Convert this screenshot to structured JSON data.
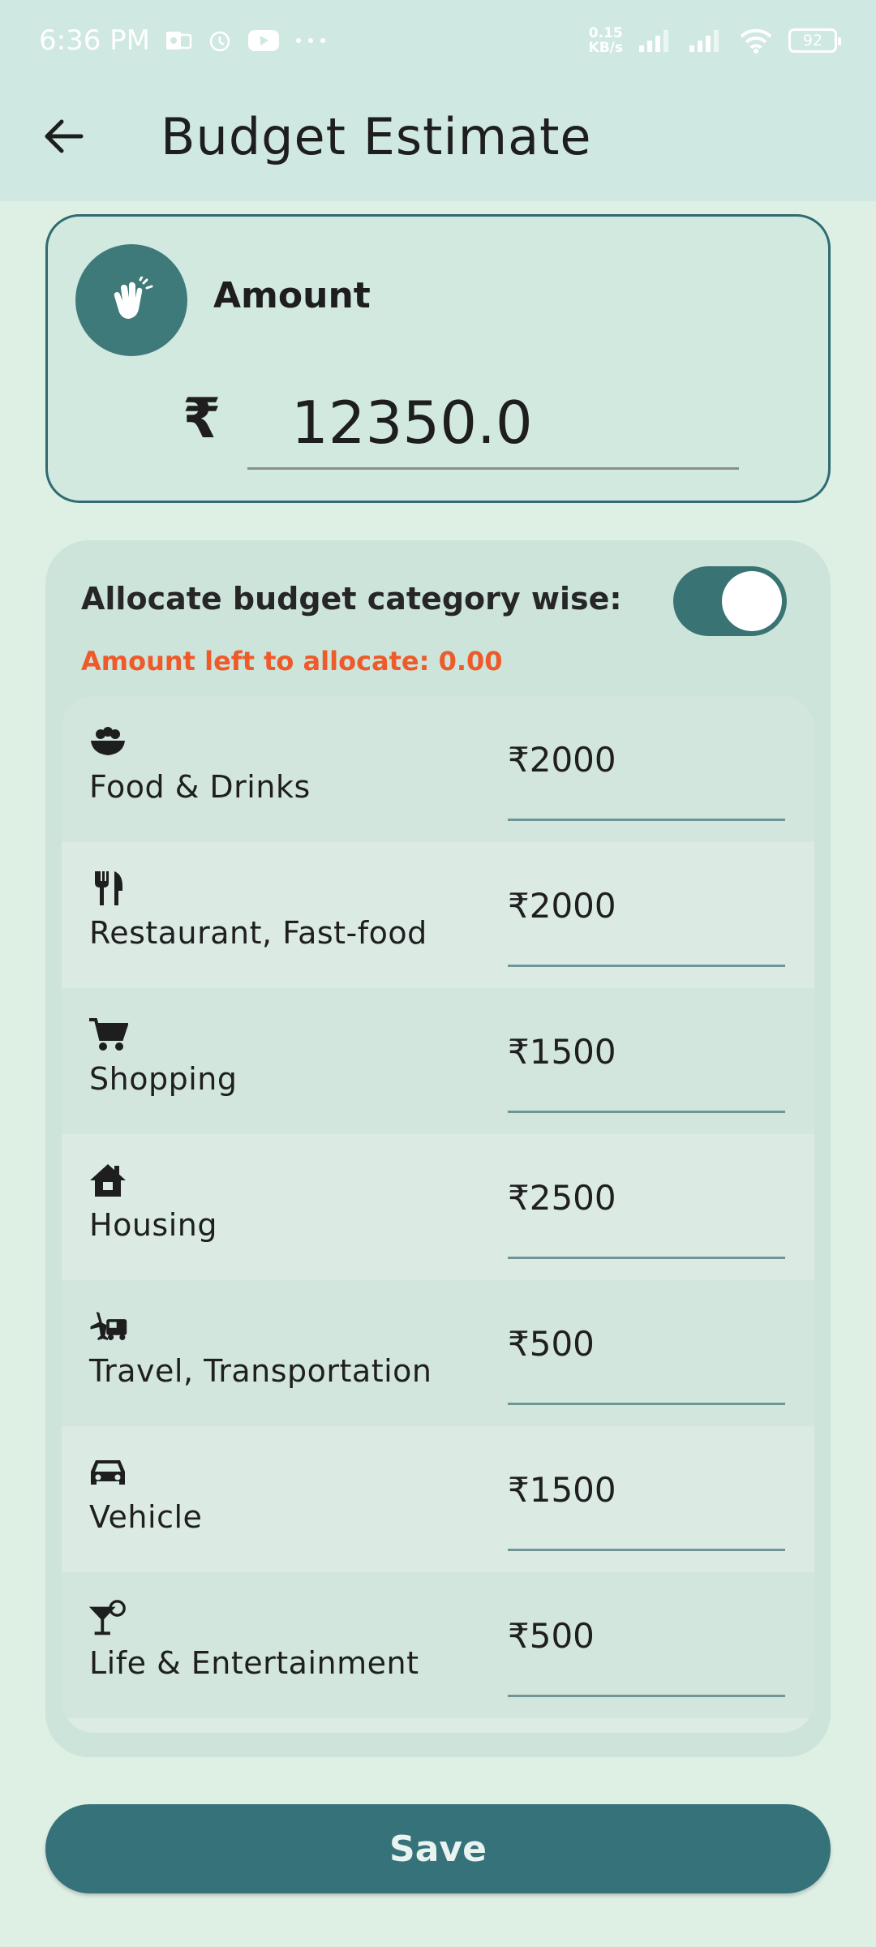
{
  "status_bar": {
    "time": "6:36 PM",
    "net_speed_value": "0.15",
    "net_speed_unit": "KB/s",
    "battery": "92"
  },
  "header": {
    "title": "Budget Estimate"
  },
  "amount_card": {
    "label": "Amount",
    "currency_symbol": "₹",
    "value": "12350.0"
  },
  "allocation": {
    "title": "Allocate budget category wise:",
    "toggle_on": true,
    "amount_left_text": "Amount left to allocate: 0.00",
    "categories": [
      {
        "name": "Food & Drinks",
        "icon": "food-bowl-icon",
        "amount": "₹2000"
      },
      {
        "name": "Restaurant, Fast-food",
        "icon": "fork-knife-icon",
        "amount": "₹2000"
      },
      {
        "name": "Shopping",
        "icon": "shopping-cart-icon",
        "amount": "₹1500"
      },
      {
        "name": "Housing",
        "icon": "house-icon",
        "amount": "₹2500"
      },
      {
        "name": "Travel, Transportation",
        "icon": "plane-truck-icon",
        "amount": "₹500"
      },
      {
        "name": "Vehicle",
        "icon": "car-icon",
        "amount": "₹1500"
      },
      {
        "name": "Life & Entertainment",
        "icon": "cocktail-icon",
        "amount": "₹500"
      }
    ]
  },
  "save_label": "Save",
  "colors": {
    "primary": "#35727a",
    "warning": "#ee5a2a",
    "background": "#deefe4"
  }
}
